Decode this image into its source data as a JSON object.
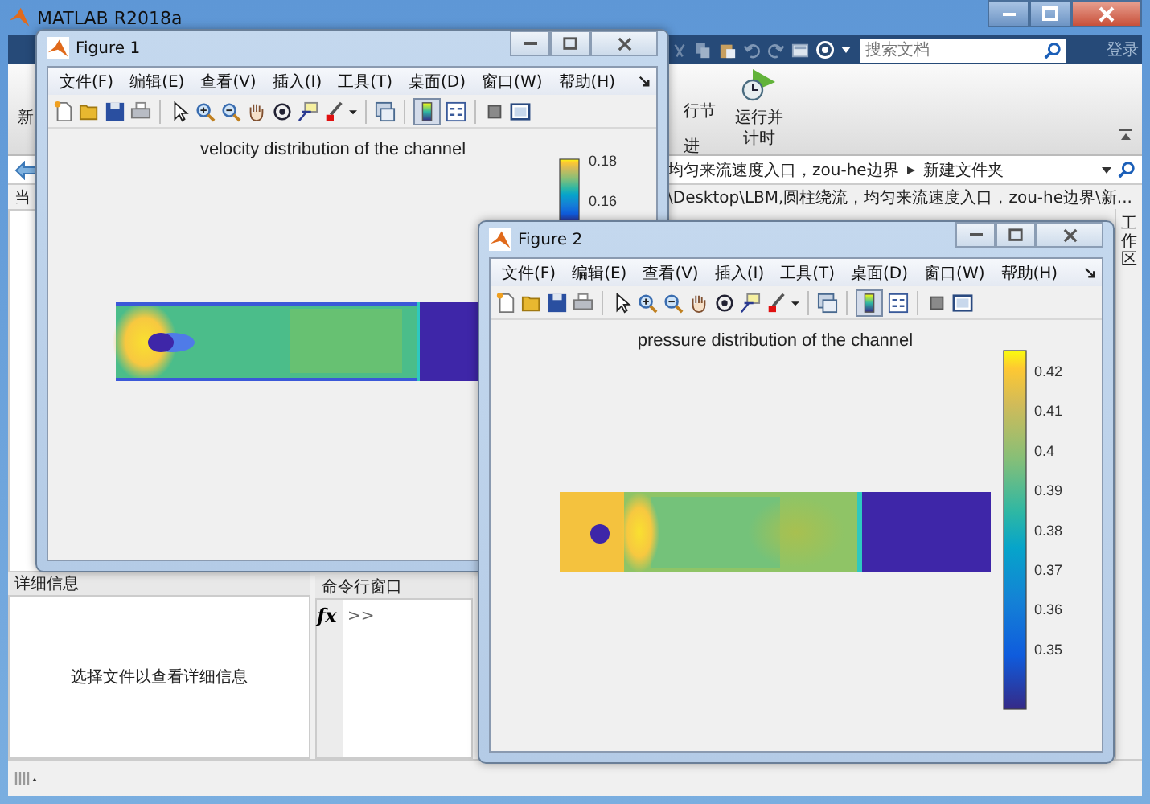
{
  "main_window": {
    "title": "MATLAB R2018a",
    "search": {
      "placeholder": "搜索文档"
    },
    "login": "登录",
    "ribbon": {
      "left_label": "新",
      "section_labels": [
        "行节",
        "进"
      ],
      "run_button_lines": [
        "运行并",
        "计时"
      ]
    },
    "address_path": [
      "均匀来流速度入口，zou-he边界",
      "新建文件夹"
    ],
    "current_path": "\\Desktop\\LBM,圆柱绕流，均匀来流速度入口，zou-he边界\\新...",
    "left_panel_title": "当",
    "side_tab": "工作区",
    "details": {
      "title": "详细信息",
      "message": "选择文件以查看详细信息"
    },
    "command_window": {
      "title": "命令行窗口",
      "fx": "fx",
      "prompt": ">>"
    }
  },
  "figures": [
    {
      "title": "Figure 1",
      "menus": [
        "文件(F)",
        "编辑(E)",
        "查看(V)",
        "插入(I)",
        "工具(T)",
        "桌面(D)",
        "窗口(W)",
        "帮助(H)"
      ],
      "colorbar_pressed": true,
      "plot": {
        "kind": "velocity",
        "title": "velocity distribution of the channel",
        "colorbar_ticks": [
          "0.18",
          "0.16"
        ]
      }
    },
    {
      "title": "Figure 2",
      "menus": [
        "文件(F)",
        "编辑(E)",
        "查看(V)",
        "插入(I)",
        "工具(T)",
        "桌面(D)",
        "窗口(W)",
        "帮助(H)"
      ],
      "colorbar_pressed": true,
      "plot": {
        "kind": "pressure",
        "title": "pressure distribution of the channel",
        "colorbar_ticks": [
          "0.42",
          "0.41",
          "0.4",
          "0.39",
          "0.38",
          "0.37",
          "0.36",
          "0.35"
        ]
      }
    }
  ]
}
